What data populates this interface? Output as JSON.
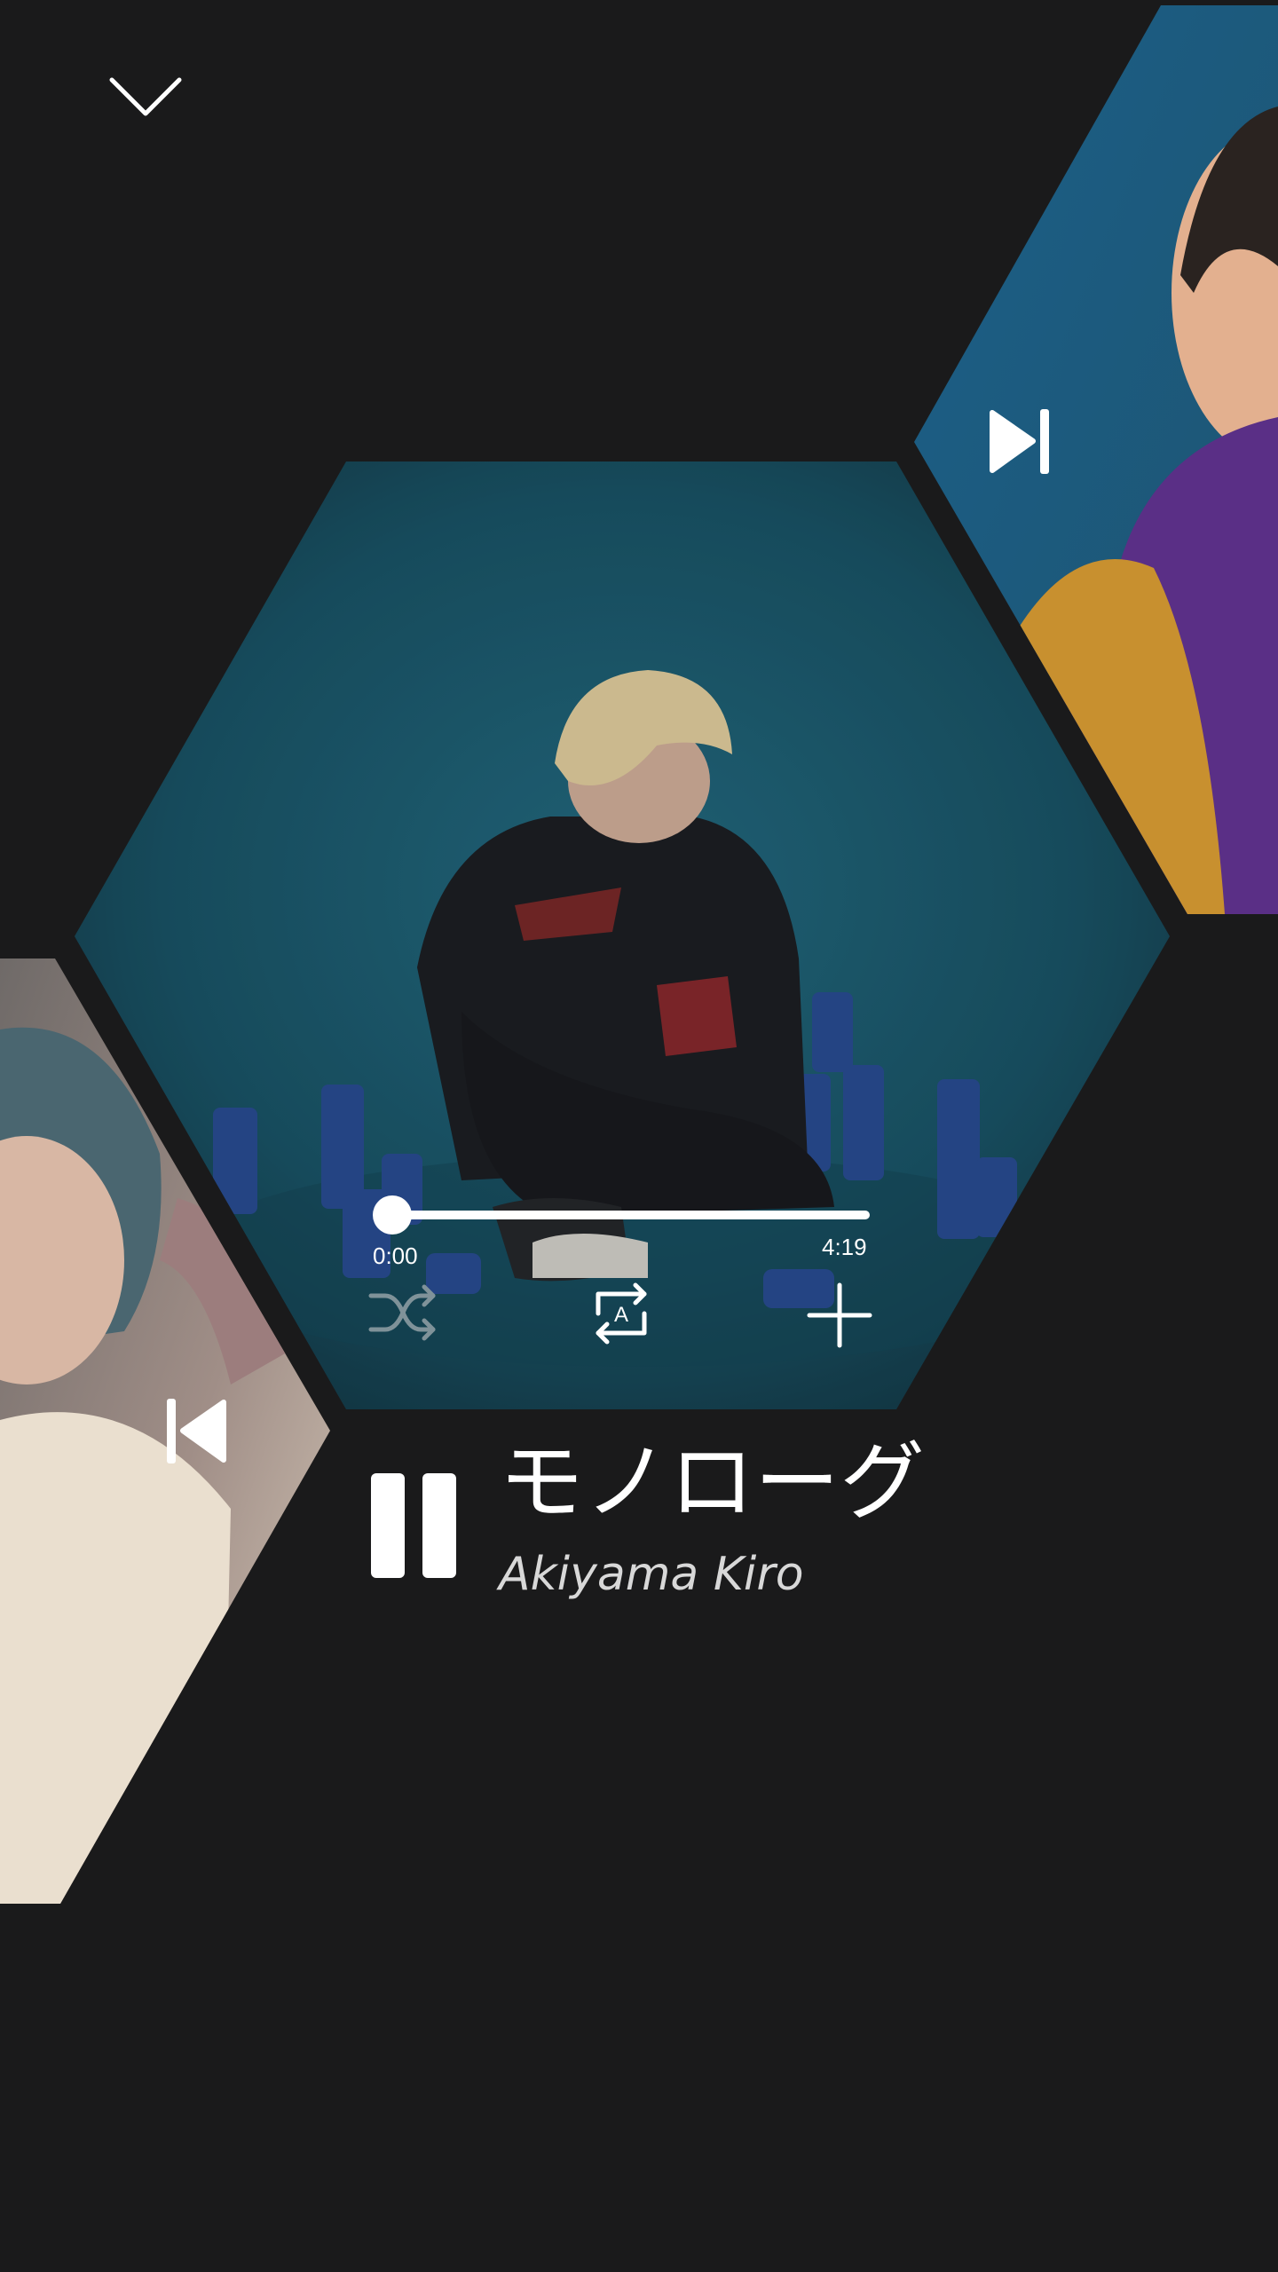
{
  "player": {
    "track_title": "モノローグ",
    "artist": "Akiyama Kiro",
    "elapsed": "0:00",
    "duration": "4:19",
    "progress": 0
  },
  "controls": {
    "collapse": "chevron-down-icon",
    "next": "skip-next-icon",
    "previous": "skip-previous-icon",
    "shuffle": "shuffle-icon",
    "repeat": "repeat-icon",
    "add": "plus-icon",
    "play_state": "pause-icon"
  },
  "colors": {
    "background": "#1a1a1b",
    "accent": "#ffffff",
    "album_current": "#1c5a6e",
    "album_next": "#1a5d86",
    "album_previous": "#8c7d79"
  }
}
